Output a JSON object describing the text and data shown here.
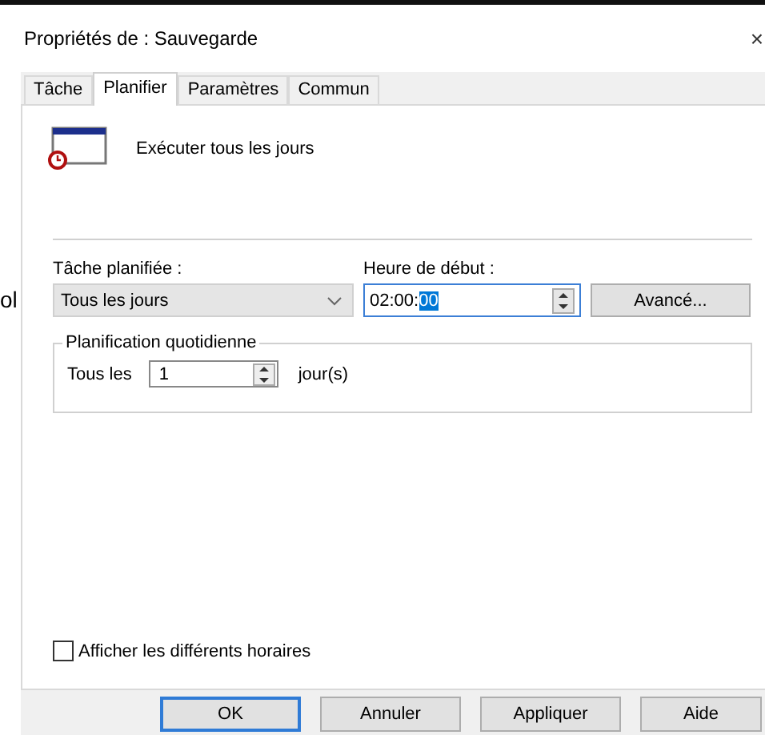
{
  "background_text": "ol",
  "window": {
    "title": "Propriétés de : Sauvegarde",
    "close": "×"
  },
  "tabs": [
    {
      "label": "Tâche",
      "selected": false
    },
    {
      "label": "Planifier",
      "selected": true
    },
    {
      "label": "Paramètres",
      "selected": false
    },
    {
      "label": "Commun",
      "selected": false
    }
  ],
  "schedule_summary": "Exécuter tous les jours",
  "schedule": {
    "label": "Tâche planifiée :",
    "value": "Tous les jours"
  },
  "start_time": {
    "label": "Heure de début :",
    "value": "02:00:",
    "selected_text": "00"
  },
  "advanced_button": "Avancé...",
  "daily_group": {
    "legend": "Planification quotidienne",
    "prefix": "Tous les",
    "value": "1",
    "suffix": "jour(s)"
  },
  "show_multiple_schedules": {
    "label": "Afficher les différents horaires",
    "checked": false
  },
  "buttons": [
    {
      "label": "OK",
      "default": true
    },
    {
      "label": "Annuler",
      "default": false
    },
    {
      "label": "Appliquer",
      "default": false
    },
    {
      "label": "Aide",
      "default": false
    }
  ]
}
